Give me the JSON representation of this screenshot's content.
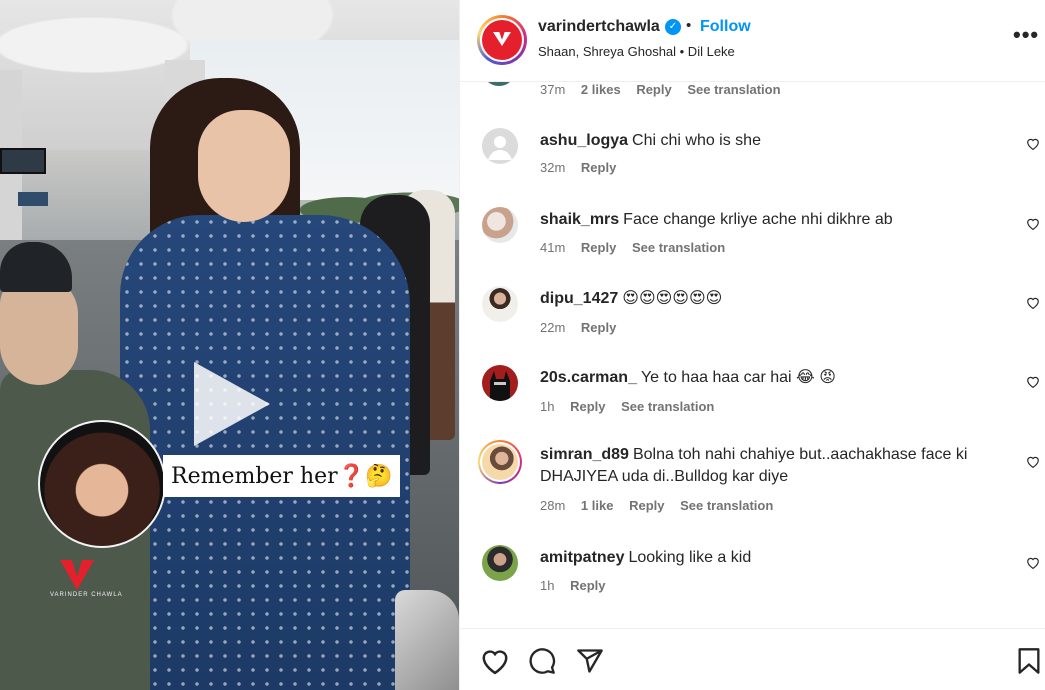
{
  "media": {
    "overlay_text": "Remember her❓🤔",
    "watermark_text": "VARINDER CHAWLA"
  },
  "header": {
    "username": "varindertchawla",
    "verified_mark": "✓",
    "separator": "•",
    "follow_label": "Follow",
    "music": "Shaan, Shreya Ghoshal • Dil Leke",
    "more_label": "•••"
  },
  "partial_comment": {
    "time": "37m",
    "likes": "2 likes",
    "reply": "Reply",
    "translation": "See translation"
  },
  "comments": [
    {
      "username": "ashu_logya",
      "text": "Chi chi who is she",
      "time": "32m",
      "likes": "",
      "reply": "Reply",
      "translation": "",
      "avatar": "default-avatar"
    },
    {
      "username": "shaik_mrs",
      "text": "Face change krliye ache nhi dikhre ab",
      "time": "41m",
      "likes": "",
      "reply": "Reply",
      "translation": "See translation",
      "avatar": "photo-avatar"
    },
    {
      "username": "dipu_1427",
      "text": "😍😍😍😍😍😍",
      "time": "22m",
      "likes": "",
      "reply": "Reply",
      "translation": "",
      "avatar": "photo-avatar"
    },
    {
      "username": "20s.carman_",
      "text": "Ye to haa haa car hai 😂 😡",
      "time": "1h",
      "likes": "",
      "reply": "Reply",
      "translation": "See translation",
      "avatar": "batman-avatar"
    },
    {
      "username": "simran_d89",
      "text": "Bolna toh nahi chahiye but..aachakhase face ki DHAJIYEA uda di..Bulldog kar diye",
      "time": "28m",
      "likes": "1 like",
      "reply": "Reply",
      "translation": "See translation",
      "avatar": "story-avatar"
    },
    {
      "username": "amitpatney",
      "text": "Looking like a kid",
      "time": "1h",
      "likes": "",
      "reply": "Reply",
      "translation": "",
      "avatar": "photo-avatar"
    }
  ],
  "actions": {
    "like": "heart-icon",
    "comment": "comment-icon",
    "share": "share-icon",
    "save": "bookmark-icon"
  },
  "colors": {
    "accent": "#0095f6",
    "brand": "#e3202b",
    "muted": "#737373"
  }
}
